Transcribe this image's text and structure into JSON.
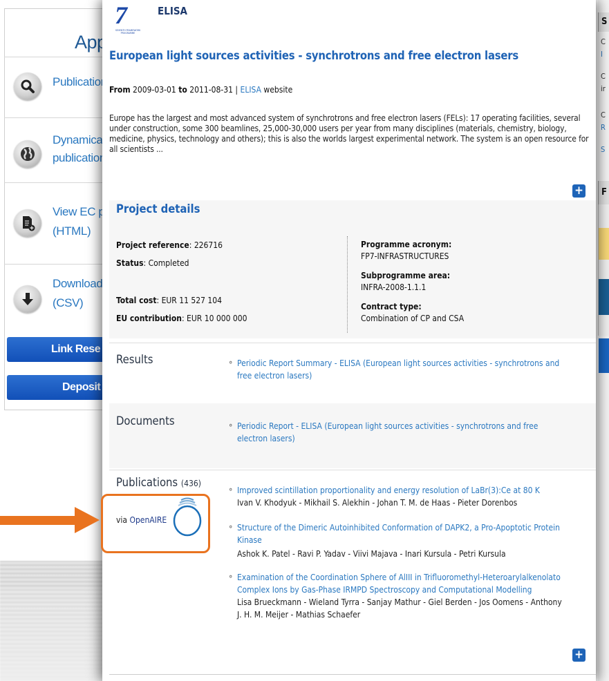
{
  "left_panel": {
    "title": "App",
    "rows": [
      {
        "label": "Publication",
        "icon": "search-icon"
      },
      {
        "label": "Dynamical publication",
        "line1": "Dynamical",
        "line2": "publication",
        "icon": "globe-icon"
      },
      {
        "label": "View EC p (HTML)",
        "line1": "View EC p",
        "line2": "(HTML)",
        "icon": "document-add-icon"
      },
      {
        "label": "Download (CSV)",
        "line1": "Download",
        "line2": "(CSV)",
        "icon": "download-icon"
      }
    ],
    "buttons": {
      "link": "Link Rese",
      "deposit": "Deposit F"
    }
  },
  "right_panel": {
    "head1": "S",
    "lines": [
      "C",
      "I",
      "C",
      "ir",
      "C",
      "R",
      "S"
    ],
    "head2": "F"
  },
  "project": {
    "acronym": "ELISA",
    "logo_text": "SEVENTH FRAMEWORK PROGRAMME",
    "title": "European light sources activities - synchrotrons and free electron lasers",
    "date_from_label": "From",
    "date_from": "2009-03-01",
    "date_to_label": "to",
    "date_to": "2011-08-31",
    "sep": "|",
    "website_link": "ELISA",
    "website_suffix": "website",
    "summary": "Europe has the largest and most advanced system of synchrotrons and free electron lasers (FELs): 17 operating facilities, several under construction, some 300 beamlines, 25,000-30,000 users per year from many disciplines (materials, chemistry, biology, medicine, physics, technology and others); this is also the worlds largest experimental network. The system is an open resource for all scientists ...",
    "plus": "+"
  },
  "details": {
    "title": "Project details",
    "reference_label": "Project reference",
    "reference": "226716",
    "status_label": "Status",
    "status": "Completed",
    "total_cost_label": "Total cost",
    "total_cost": "EUR 11 527 104",
    "eu_contribution_label": "EU contribution",
    "eu_contribution": "EUR 10 000 000",
    "programme_label": "Programme acronym:",
    "programme": "FP7-INFRASTRUCTURES",
    "subprogramme_label": "Subprogramme area:",
    "subprogramme": "INFRA-2008-1.1.1",
    "contract_label": "Contract type:",
    "contract": "Combination of CP and CSA"
  },
  "results": {
    "title": "Results",
    "items": [
      {
        "title_line1": "Periodic Report Summary - ELISA (European light sources activities - synchrotrons and",
        "title_line2": "free electron lasers)"
      }
    ]
  },
  "documents": {
    "title": "Documents",
    "items": [
      {
        "title_line1": "Periodic Report - ELISA (European light sources activities - synchrotrons and free",
        "title_line2": "electron lasers)"
      }
    ]
  },
  "publications": {
    "title": "Publications",
    "count": "(436)",
    "via_label": "via",
    "via_link": "OpenAIRE",
    "items": [
      {
        "title": "Improved scintillation proportionality and energy resolution of LaBr(3):Ce at 80 K",
        "authors": "Ivan V. Khodyuk - Mikhail S. Alekhin - Johan T. M. de Haas - Pieter Dorenbos"
      },
      {
        "title_line1": "Structure of the Dimeric Autoinhibited Conformation of DAPK2, a Pro-Apoptotic Protein",
        "title_line2": "Kinase",
        "authors": "Ashok K. Patel - Ravi P. Yadav - Viivi Majava - Inari Kursula - Petri Kursula"
      },
      {
        "title_line1": "Examination of the Coordination Sphere of AlIII in Trifluoromethyl-Heteroarylalkenolato",
        "title_line2": "Complex Ions by Gas-Phase IRMPD Spectroscopy and Computational Modelling",
        "authors_line1": "Lisa Brueckmann - Wieland Tyrra - Sanjay Mathur - Giel Berden - Jos Oomens - Anthony",
        "authors_line2": "J. H. M. Meijer - Mathias Schaefer"
      }
    ]
  },
  "colors": {
    "highlight": "#e9731f",
    "link": "#2a78c0",
    "title_blue": "#1f63b5",
    "button_blue": "#1e64b8"
  }
}
